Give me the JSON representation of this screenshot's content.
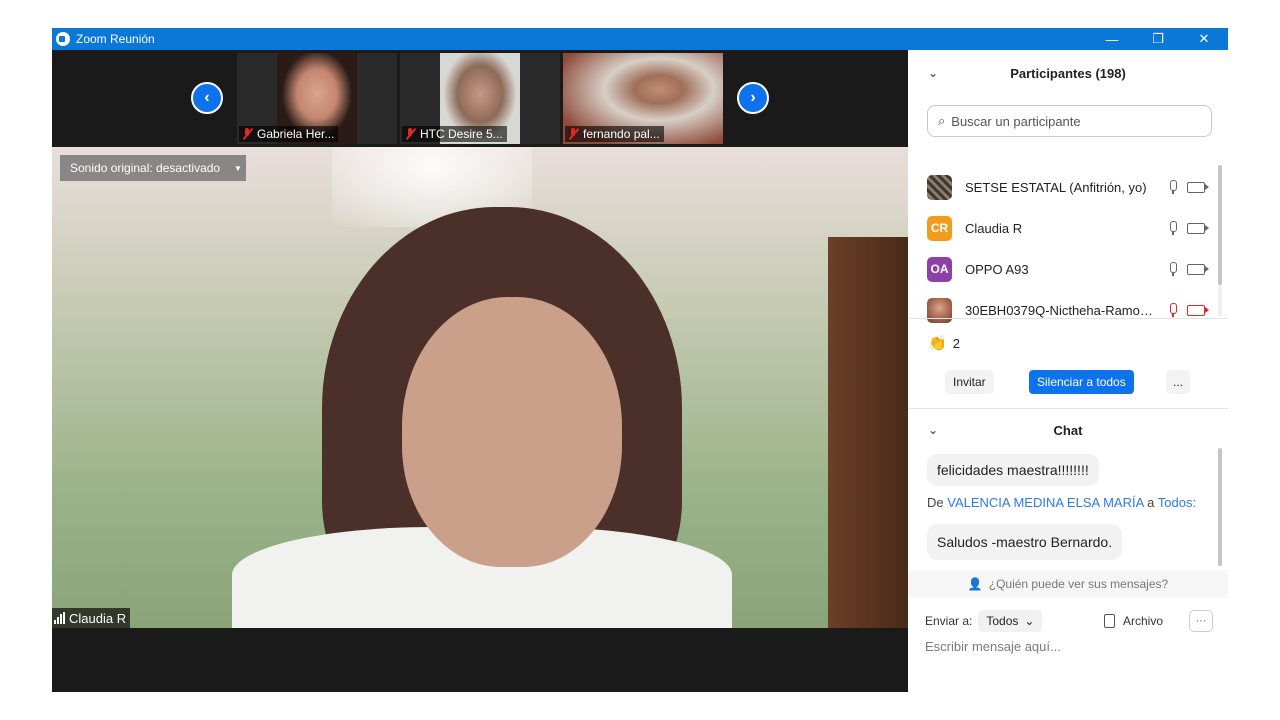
{
  "window": {
    "title": "Zoom Reunión",
    "minimize_glyph": "—",
    "maximize_glyph": "❐",
    "close_glyph": "✕"
  },
  "thumbnails": [
    {
      "name": "Gabriela Her...",
      "muted": true
    },
    {
      "name": "HTC Desire 5...",
      "muted": true
    },
    {
      "name": "fernando pal...",
      "muted": true
    }
  ],
  "video": {
    "sound_button": "Sonido original: desactivado",
    "active_speaker": "Claudia R"
  },
  "participants": {
    "title": "Participantes (198)",
    "search_placeholder": "Buscar un participante",
    "list": [
      {
        "name": "SETSE ESTATAL (Anfitrión, yo)",
        "initials": "",
        "avatar_color": "#6b5a4a"
      },
      {
        "name": "Claudia R",
        "initials": "CR",
        "avatar_color": "#f29b1d"
      },
      {
        "name": "OPPO A93",
        "initials": "OA",
        "avatar_color": "#8e3fa8"
      },
      {
        "name": "30EBH0379Q-Nictheha-Ramos ...",
        "initials": "",
        "avatar_color": "#b0705a"
      }
    ],
    "reaction_count": "2",
    "invite_label": "Invitar",
    "mute_all_label": "Silenciar a todos",
    "more_label": "..."
  },
  "chat": {
    "title": "Chat",
    "messages": [
      {
        "text": "felicidades maestra!!!!!!!!"
      },
      {
        "text": "Saludos -maestro Bernardo."
      }
    ],
    "from_prefix": "De",
    "from_sender": "VALENCIA MEDINA ELSA MARÍA",
    "from_middle": "a",
    "from_target": "Todos:",
    "who_can_see": "¿Quién puede ver sus mensajes?",
    "send_to_label": "Enviar a:",
    "send_to_value": "Todos",
    "file_label": "Archivo",
    "more_label": "···",
    "input_placeholder": "Escribir mensaje aquí..."
  }
}
